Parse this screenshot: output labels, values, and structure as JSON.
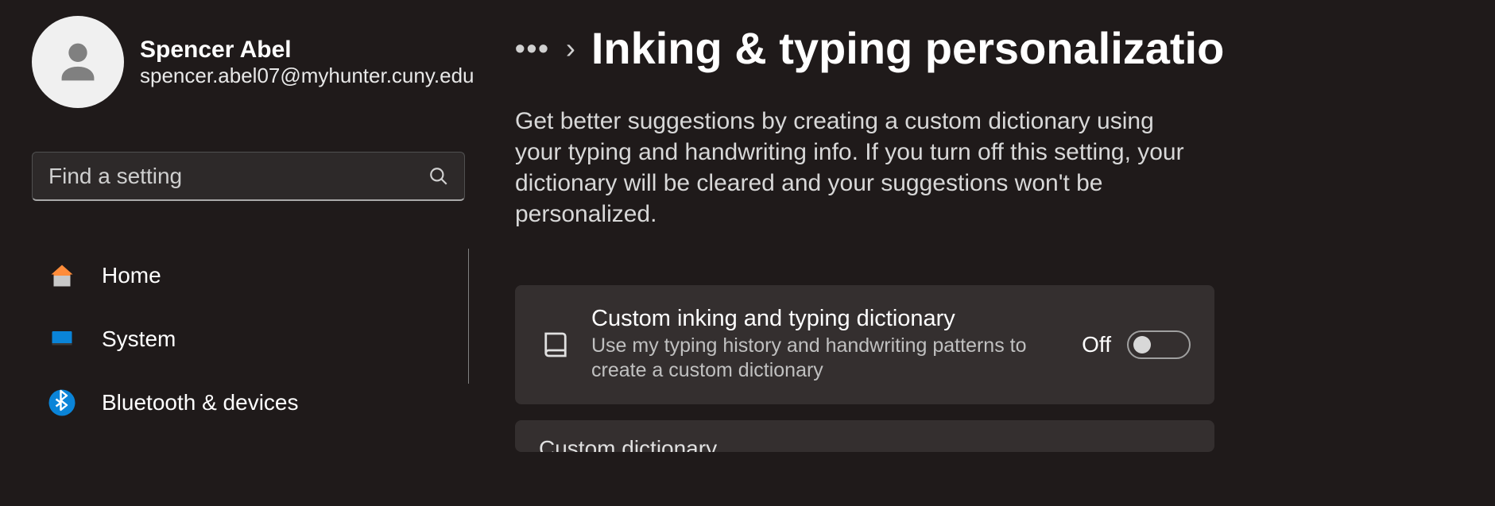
{
  "user": {
    "name": "Spencer Abel",
    "email": "spencer.abel07@myhunter.cuny.edu"
  },
  "search": {
    "placeholder": "Find a setting"
  },
  "sidebar": {
    "items": [
      {
        "label": "Home"
      },
      {
        "label": "System"
      },
      {
        "label": "Bluetooth & devices"
      }
    ]
  },
  "breadcrumb": {
    "dots": "•••",
    "title": "Inking & typing personalizatio"
  },
  "description": "Get better suggestions by creating a custom dictionary using your typing and handwriting info. If you turn off this setting, your dictionary will be cleared and your suggestions won't be personalized.",
  "settings": {
    "custom_dictionary": {
      "title": "Custom inking and typing dictionary",
      "subtitle": "Use my typing history and handwriting patterns to create a custom dictionary",
      "state_label": "Off",
      "state": false
    },
    "second_card": {
      "title": "Custom dictionary"
    }
  }
}
